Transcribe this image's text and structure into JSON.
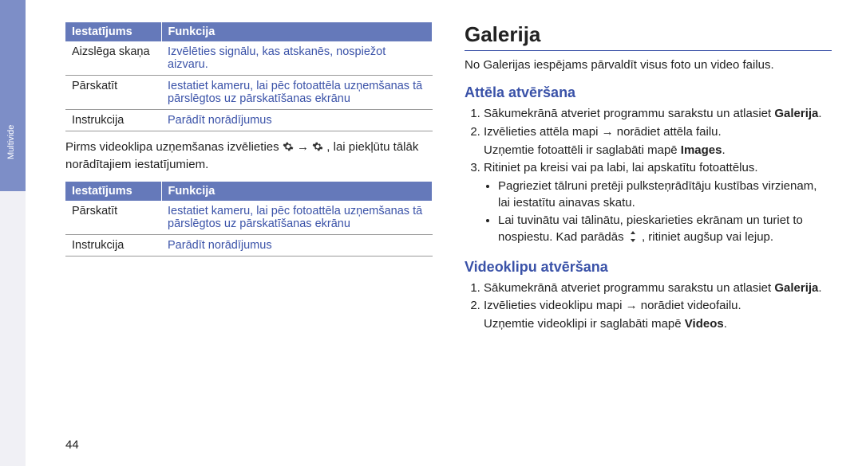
{
  "side_label": "Multivide",
  "page_number": "44",
  "left": {
    "table1": {
      "headers": {
        "setting": "Iestatījums",
        "function": "Funkcija"
      },
      "rows": [
        {
          "label": "Aizslēga skaņa",
          "func": "Izvēlēties signālu, kas atskanēs, nospiežot aizvaru."
        },
        {
          "label": "Pārskatīt",
          "func": "Iestatiet kameru, lai pēc fotoattēla uzņemšanas tā pārslēgtos uz pārskatīšanas ekrānu"
        },
        {
          "label": "Instrukcija",
          "func": "Parādīt norādījumus"
        }
      ]
    },
    "between": {
      "pre": "Pirms videoklipa uzņemšanas izvēlieties ",
      "mid": " → ",
      "post": ", lai piekļūtu tālāk norādītajiem iestatījumiem."
    },
    "table2": {
      "headers": {
        "setting": "Iestatījums",
        "function": "Funkcija"
      },
      "rows": [
        {
          "label": "Pārskatīt",
          "func": "Iestatiet kameru, lai pēc fotoattēla uzņemšanas tā pārslēgtos uz pārskatīšanas ekrānu"
        },
        {
          "label": "Instrukcija",
          "func": "Parādīt norādījumus"
        }
      ]
    }
  },
  "right": {
    "title": "Galerija",
    "intro": "No Galerijas iespējams pārvaldīt visus foto un video failus.",
    "section1": {
      "heading": "Attēla atvēršana",
      "step1_a": "Sākumekrānā atveriet programmu sarakstu un atlasiet ",
      "step1_b": "Galerija",
      "step1_c": ".",
      "step2": "Izvēlieties attēla mapi → norādiet attēla failu.",
      "step2_note_a": "Uzņemtie fotoattēli ir saglabāti mapē ",
      "step2_note_b": "Images",
      "step2_note_c": ".",
      "step3": "Ritiniet pa kreisi vai pa labi, lai apskatītu fotoattēlus.",
      "bullet1": "Pagrieziet tālruni pretēji pulksteņrādītāju kustības virzienam, lai iestatītu ainavas skatu.",
      "bullet2_a": "Lai tuvinātu vai tālinātu, pieskarieties ekrānam un turiet to nospiestu. Kad parādās ",
      "bullet2_b": ", ritiniet augšup vai lejup."
    },
    "section2": {
      "heading": "Videoklipu atvēršana",
      "step1_a": "Sākumekrānā atveriet programmu sarakstu un atlasiet ",
      "step1_b": "Galerija",
      "step1_c": ".",
      "step2": "Izvēlieties videoklipu mapi → norādiet videofailu.",
      "step2_note_a": "Uzņemtie videoklipi ir saglabāti mapē ",
      "step2_note_b": "Videos",
      "step2_note_c": "."
    }
  }
}
